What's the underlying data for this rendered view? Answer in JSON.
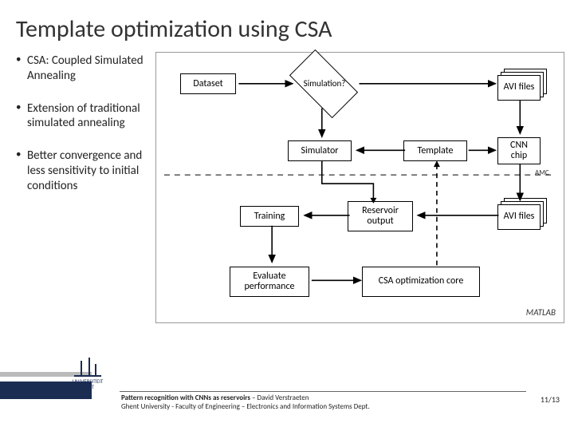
{
  "title": "Template optimization using CSA",
  "bullets": [
    "CSA: Coupled Simulated Annealing",
    "Extension of traditional simulated annealing",
    "Better convergence and less sensitivity to initial conditions"
  ],
  "diagram": {
    "dataset": "Dataset",
    "simulation": "Simulation?",
    "avi_top": "AVI files",
    "simulator": "Simulator",
    "template": "Template",
    "cnn_chip": "CNN chip",
    "training": "Training",
    "reservoir": "Reservoir output",
    "avi_bottom": "AVI files",
    "evaluate": "Evaluate performance",
    "csa_core": "CSA optimization core",
    "amc": "AMC",
    "matlab": "MATLAB"
  },
  "footer": {
    "logo_line1": "UNIVERSITEIT",
    "logo_line2": "GENT",
    "line1_bold": "Pattern recognition with CNNs as reservoirs",
    "line1_rest": " – David Verstraeten",
    "line2": "Ghent University - Faculty of Engineering – Electronics and Information Systems Dept.",
    "page": "11/13"
  }
}
